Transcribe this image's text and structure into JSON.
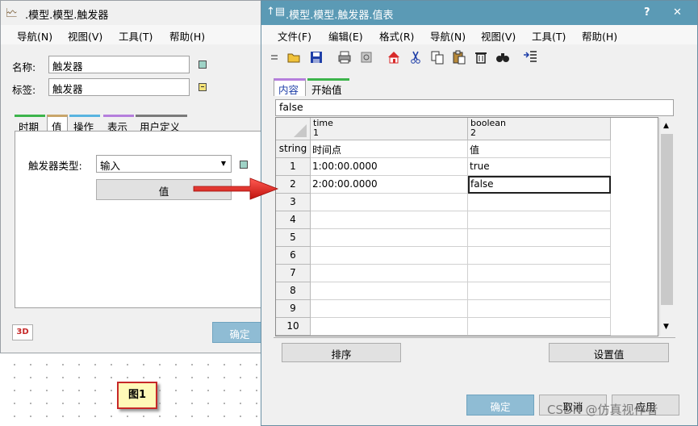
{
  "background_window": {
    "app_icon_text": "🗠",
    "title": ".模型.模型.触发器",
    "menu": [
      "导航(N)",
      "视图(V)",
      "工具(T)",
      "帮助(H)"
    ],
    "name_label": "名称:",
    "name_value": "触发器",
    "tag_label": "标签:",
    "tag_value": "触发器",
    "tabs": [
      {
        "label": "时期",
        "color": "#3cb44b"
      },
      {
        "label": "值",
        "color": "#c9a66b"
      },
      {
        "label": "操作",
        "color": "#59b4e0"
      },
      {
        "label": "表示",
        "color": "#b57edc"
      },
      {
        "label": "用户定义",
        "color": "#7a7a7a"
      }
    ],
    "trigger_type_label": "触发器类型:",
    "trigger_type_value": "输入",
    "value_button": "值",
    "badge_3d": "3D",
    "ok_button": "确定"
  },
  "figure_label": "图1",
  "table_window": {
    "title_icon_text": "↑▤",
    "title": ".模型.模型.触发器.值表",
    "help_glyph": "?",
    "close_glyph": "✕",
    "menu": [
      "文件(F)",
      "编辑(E)",
      "格式(R)",
      "导航(N)",
      "视图(V)",
      "工具(T)",
      "帮助(H)"
    ],
    "toolbar_icons": [
      "grip-icon",
      "open-folder-icon",
      "save-icon",
      "print-icon",
      "print-preview-icon",
      "home-icon",
      "cut-icon",
      "copy-icon",
      "paste-icon",
      "delete-icon",
      "find-icon",
      "indent-icon"
    ],
    "tabs": [
      {
        "label": "内容",
        "color": "#b57edc"
      },
      {
        "label": "开始值",
        "color": "#3cb44b"
      }
    ],
    "cell_editor_value": "false",
    "columns": [
      {
        "name": "time",
        "index": "1",
        "type": "时间点"
      },
      {
        "name": "boolean",
        "index": "2",
        "type": "值"
      }
    ],
    "type_row_label": "string",
    "rows": [
      {
        "n": "1",
        "time": "1:00:00.0000",
        "value": "true"
      },
      {
        "n": "2",
        "time": "2:00:00.0000",
        "value": "false"
      },
      {
        "n": "3",
        "time": "",
        "value": ""
      },
      {
        "n": "4",
        "time": "",
        "value": ""
      },
      {
        "n": "5",
        "time": "",
        "value": ""
      },
      {
        "n": "6",
        "time": "",
        "value": ""
      },
      {
        "n": "7",
        "time": "",
        "value": ""
      },
      {
        "n": "8",
        "time": "",
        "value": ""
      },
      {
        "n": "9",
        "time": "",
        "value": ""
      },
      {
        "n": "10",
        "time": "",
        "value": ""
      }
    ],
    "sort_button": "排序",
    "set_value_button": "设置值",
    "ok_button": "确定",
    "cancel_button": "取消",
    "apply_button": "应用"
  },
  "watermark": "CSDN @仿真视作者",
  "colors": {
    "title_active": "#5b9ab5",
    "ok_button": "#8fbcd4",
    "arrow": "#e0201c",
    "figure_label_bg": "#fff9b8",
    "figure_label_border": "#c62828"
  }
}
